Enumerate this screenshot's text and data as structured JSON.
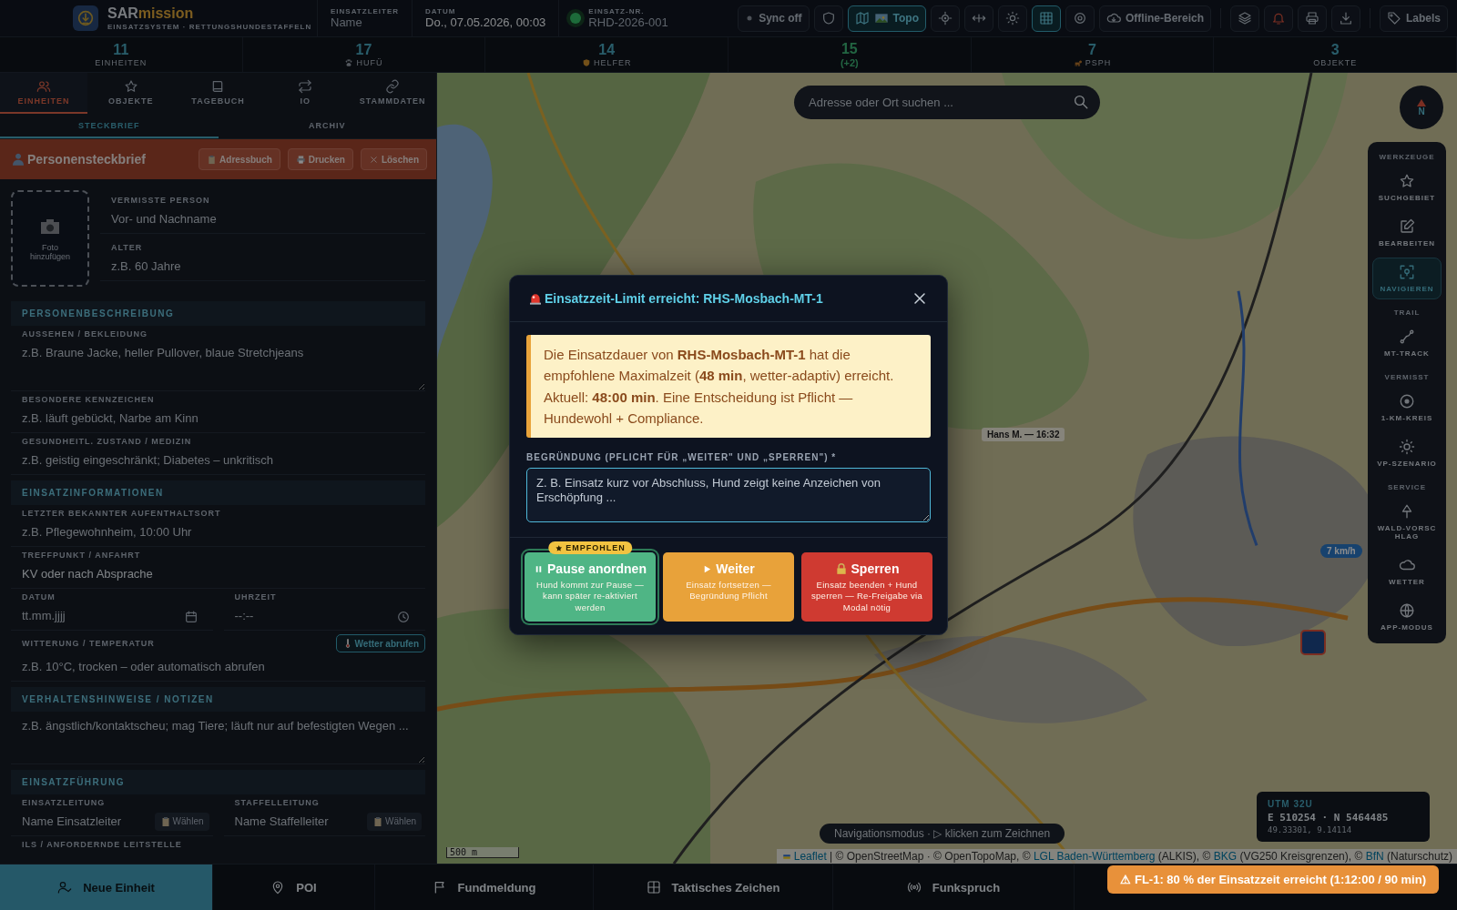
{
  "header": {
    "brand": {
      "part_1": "SAR",
      "part_2": "mission",
      "subtitle": "EINSATZSYSTEM · RETTUNGSHUNDESTAFFELN"
    },
    "fields": [
      {
        "label": "EINSATZLEITER",
        "placeholder": "Name"
      },
      {
        "label": "DATUM",
        "value": "Do., 07.05.2026, 00:03"
      },
      {
        "label": "EINSATZ-NR.",
        "placeholder": "RHD-2026-001"
      }
    ],
    "online": true,
    "toolbar": [
      [
        {
          "kind": "text",
          "label": "Sync off",
          "selected": false
        },
        {
          "kind": "icon",
          "selected": false
        },
        {
          "kind": "text",
          "label": "Topo",
          "selected": true
        },
        {
          "kind": "icon",
          "selected": false
        },
        {
          "kind": "icon",
          "selected": false
        },
        {
          "kind": "icon",
          "selected": false
        },
        {
          "kind": "icon",
          "selected": true
        },
        {
          "kind": "icon",
          "selected": false
        },
        {
          "kind": "text",
          "label": "Offline-Bereich",
          "selected": false
        }
      ],
      [
        {
          "kind": "icon",
          "selected": false
        },
        {
          "kind": "icon",
          "selected": false
        },
        {
          "kind": "icon",
          "selected": false
        },
        {
          "kind": "icon",
          "selected": false
        }
      ],
      [
        {
          "kind": "text",
          "label": "Labels",
          "selected": false
        }
      ]
    ]
  },
  "stats": [
    {
      "value": "11",
      "label": "EINHEITEN"
    },
    {
      "value": "17",
      "label": "HUFÜ"
    },
    {
      "value": "14",
      "label": "HELFER"
    },
    {
      "value": "15",
      "delta": "(+2)"
    },
    {
      "value": "7",
      "label": "PSPH"
    },
    {
      "value": "3",
      "label": "OBJEKTE"
    }
  ],
  "left_panel": {
    "tabs": [
      {
        "label": "EINHEITEN",
        "selected": true
      },
      {
        "label": "OBJEKTE",
        "selected": false
      },
      {
        "label": "TAGEBUCH",
        "selected": false
      },
      {
        "label": "IO",
        "selected": false
      },
      {
        "label": "STAMMDATEN",
        "selected": false
      }
    ],
    "subtabs": [
      {
        "label": "STECKBRIEF",
        "selected": true
      },
      {
        "label": "ARCHIV",
        "selected": false
      }
    ],
    "profile": {
      "title": "Personensteckbrief",
      "buttons": [
        "Adressbuch",
        "Drucken",
        "Löschen"
      ],
      "photo_label": "Foto hinzufügen",
      "fields": [
        {
          "label": "VERMISSTE PERSON",
          "placeholder": "Vor- und Nachname"
        },
        {
          "label": "ALTER",
          "placeholder": "z.B. 60 Jahre"
        }
      ]
    },
    "sections": [
      {
        "title": "PERSONENBESCHREIBUNG",
        "fields": [
          {
            "kind": "textarea",
            "label": "AUSSEHEN / BEKLEIDUNG",
            "placeholder": "z.B. Braune Jacke, heller Pullover, blaue Stretchjeans"
          },
          {
            "kind": "input",
            "label": "BESONDERE KENNZEICHEN",
            "placeholder": "z.B. läuft gebückt, Narbe am Kinn"
          },
          {
            "kind": "input",
            "label": "GESUNDHEITL. ZUSTAND / MEDIZIN",
            "placeholder": "z.B. geistig eingeschränkt; Diabetes – unkritisch"
          }
        ]
      },
      {
        "title": "EINSATZINFORMATIONEN",
        "fields": [
          {
            "kind": "input",
            "label": "LETZTER BEKANNTER AUFENTHALTSORT",
            "placeholder": "z.B. Pflegewohnheim, 10:00 Uhr"
          },
          {
            "kind": "input",
            "label": "TREFFPUNKT / ANFAHRT",
            "value": "KV oder nach Absprache"
          },
          {
            "kind": "pair",
            "items": [
              {
                "kind": "date",
                "label": "DATUM",
                "placeholder": "tt.mm.jjjj"
              },
              {
                "kind": "time",
                "label": "UHRZEIT",
                "placeholder": "--:--"
              }
            ]
          },
          {
            "kind": "weather",
            "label": "WITTERUNG / TEMPERATUR",
            "button": "Wetter abrufen",
            "placeholder": "z.B. 10°C, trocken – oder automatisch abrufen"
          }
        ]
      },
      {
        "title": "VERHALTENSHINWEISE / NOTIZEN",
        "fields": [
          {
            "kind": "textarea",
            "placeholder": "z.B. ängstlich/kontaktscheu; mag Tiere; läuft nur auf befestigten Wegen ..."
          }
        ]
      },
      {
        "title": "EINSATZFÜHRUNG",
        "fields": [
          {
            "kind": "pair",
            "items": [
              {
                "kind": "pick",
                "label": "EINSATZLEITUNG",
                "placeholder": "Name Einsatzleiter",
                "button": "Wählen"
              },
              {
                "kind": "pick",
                "label": "STAFFELLEITUNG",
                "placeholder": "Name Staffelleiter",
                "button": "Wählen"
              }
            ]
          },
          {
            "kind": "label",
            "label": "ILS / ANFORDERNDE LEITSTELLE"
          }
        ]
      }
    ]
  },
  "map": {
    "search": {
      "placeholder": "Adresse oder Ort suchen ..."
    },
    "compass": "N",
    "markers": [
      {
        "kind": "label",
        "text": "Hans M. — 16:32"
      },
      {
        "kind": "speed",
        "text": "7 km/h"
      },
      {
        "kind": "unit"
      }
    ],
    "tools": [
      {
        "title": "WERKZEUGE",
        "items": [
          {
            "label": "SUCHGEBIET",
            "selected": false
          },
          {
            "label": "BEARBEITEN",
            "selected": false
          },
          {
            "label": "NAVIGIEREN",
            "selected": true
          }
        ]
      },
      {
        "title": "TRAIL",
        "items": [
          {
            "label": "MT-TRACK",
            "selected": false
          }
        ]
      },
      {
        "title": "VERMISST",
        "items": [
          {
            "label": "1-KM-KREIS",
            "selected": false
          },
          {
            "label": "VP-SZENARIO",
            "selected": false
          }
        ]
      },
      {
        "title": "SERVICE",
        "items": [
          {
            "label": "WALD-VORSCHLAG",
            "selected": false
          },
          {
            "label": "WETTER",
            "selected": false
          },
          {
            "label": "APP-MODUS",
            "selected": false
          }
        ]
      }
    ],
    "coordinates": {
      "zone": "UTM 32U",
      "utm": "E 510254 · N 5464485",
      "latlon": "49.33301, 9.14114"
    },
    "scale": "500 m",
    "hint": "Navigationsmodus · ▷ klicken zum Zeichnen",
    "attribution": [
      {
        "kind": "link",
        "text": "Leaflet"
      },
      {
        "kind": "text",
        "text": " | © OpenStreetMap · © OpenTopoMap, © "
      },
      {
        "kind": "link",
        "text": "LGL Baden-Württemberg"
      },
      {
        "kind": "text",
        "text": " (ALKIS), © "
      },
      {
        "kind": "link",
        "text": "BKG"
      },
      {
        "kind": "text",
        "text": " (VG250 Kreisgrenzen), © "
      },
      {
        "kind": "link",
        "text": "BfN"
      },
      {
        "kind": "text",
        "text": " (Naturschutz)"
      }
    ]
  },
  "bottom_bar": [
    {
      "label": "Neue Einheit",
      "selected": true
    },
    {
      "label": "POI",
      "selected": false
    },
    {
      "label": "Fundmeldung",
      "selected": false
    },
    {
      "label": "Taktisches Zeichen",
      "selected": false
    },
    {
      "label": "Funkspruch",
      "selected": false
    }
  ],
  "modal": {
    "title": "Einsatzzeit-Limit erreicht: RHS-Mosbach-MT-1",
    "alert": [
      "Die Einsatzdauer von **RHS-Mosbach-MT-1** hat die empfohlene Maximalzeit (**48 min**, wetter-adaptiv) erreicht.",
      "Aktuell: **48:00 min**. Eine Entscheidung ist Pflicht — Hundewohl + Compliance."
    ],
    "reason_label": "BEGRÜNDUNG (PFLICHT FÜR „WEITER\" UND „SPERREN\") *",
    "reason_placeholder": "Z. B. Einsatz kurz vor Abschluss, Hund zeigt keine Anzeichen von Erschöpfung ...",
    "actions": [
      {
        "kind": "pause",
        "title": "Pause anordnen",
        "description": "Hund kommt zur Pause — kann später re-aktiviert werden",
        "badge": "EMPFOHLEN"
      },
      {
        "kind": "continue",
        "title": "Weiter",
        "description": "Einsatz fortsetzen — Begründung Pflicht"
      },
      {
        "kind": "lock",
        "title": "Sperren",
        "description": "Einsatz beenden + Hund sperren — Re-Freigabe via Modal nötig"
      }
    ]
  },
  "toast": "⚠ FL-1: 80 % der Einsatzzeit erreicht (1:12:00 / 90 min)"
}
